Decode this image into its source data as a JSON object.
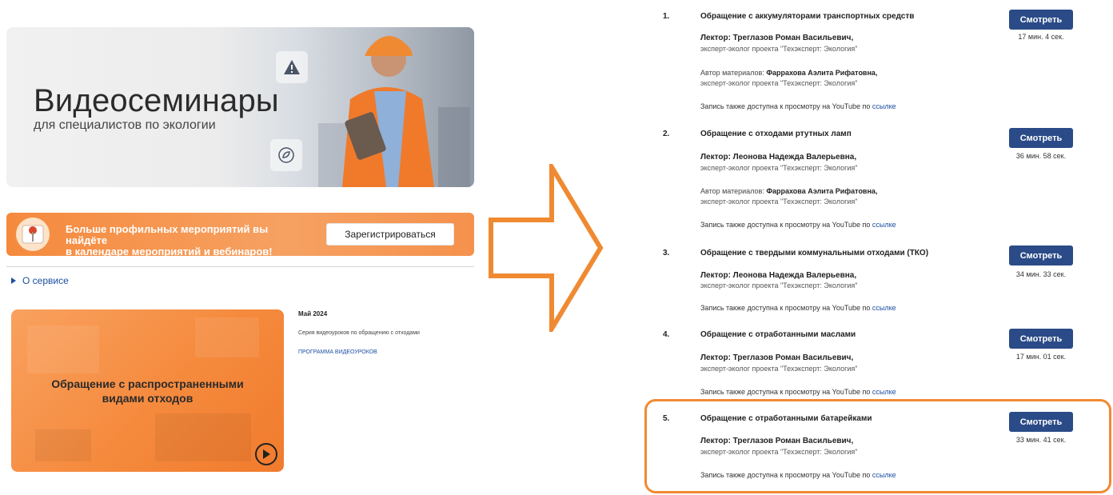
{
  "banner": {
    "title": "Видеосеминары",
    "subtitle": "для специалистов по экологии"
  },
  "promo": {
    "text_line1": "Больше профильных мероприятий вы найдёте",
    "text_line2": "в календаре мероприятий и вебинаров!",
    "register_label": "Зарегистрироваться"
  },
  "about_label": "О сервисе",
  "card": {
    "title_line1": "Обращение с распространенными",
    "title_line2": "видами отходов"
  },
  "info": {
    "date": "Май 2024",
    "series": "Серия видеоуроков по обращению с отходами",
    "program_link": "ПРОГРАММА ВИДЕОУРОКОВ"
  },
  "common": {
    "watch_label": "Смотреть",
    "role": "эксперт-эколог проекта \"Техэксперт: Экология\"",
    "author_prefix": "Автор материалов: ",
    "yt_text": "Запись также доступна к просмотру на YouTube по ",
    "yt_link": "ссылке"
  },
  "lessons": [
    {
      "number": "1.",
      "title": "Обращение с аккумуляторами транспортных средств",
      "lecturer": "Лектор: Треглазов Роман Васильевич,",
      "author_name": "Фаррахова Аэлита Рифатовна,",
      "duration": "17 мин. 4 сек."
    },
    {
      "number": "2.",
      "title": "Обращение с отходами ртутных ламп",
      "lecturer": "Лектор: Леонова Надежда Валерьевна,",
      "author_name": "Фаррахова Аэлита Рифатовна,",
      "duration": "36 мин. 58 сек."
    },
    {
      "number": "3.",
      "title": "Обращение с твердыми коммунальными отходами (ТКО)",
      "lecturer": "Лектор: Леонова Надежда Валерьевна,",
      "duration": "34 мин. 33 сек."
    },
    {
      "number": "4.",
      "title": "Обращение с отработанными маслами",
      "lecturer": "Лектор: Треглазов Роман Васильевич,",
      "duration": "17 мин. 01 сек."
    },
    {
      "number": "5.",
      "title": "Обращение с отработанными батарейками",
      "lecturer": "Лектор: Треглазов Роман Васильевич,",
      "duration": "33 мин. 41 сек."
    }
  ],
  "colors": {
    "accent_orange": "#f58a3d",
    "button_blue": "#2a4b87",
    "link_blue": "#1c4fa0"
  }
}
